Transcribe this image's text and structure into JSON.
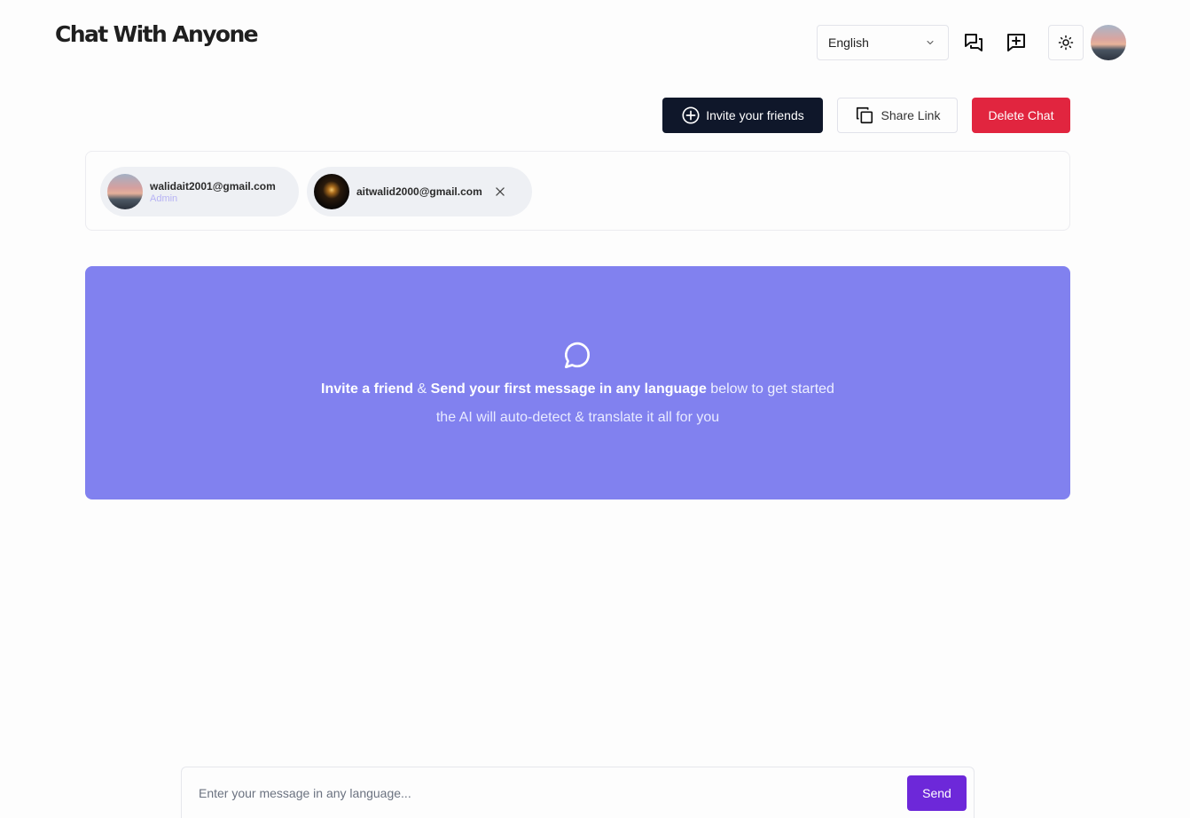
{
  "header": {
    "logo": "Chat With Anyone",
    "language": {
      "selected": "English",
      "icon": "chevron-down-icon"
    },
    "icons": [
      "chat-list-icon",
      "new-chat-icon",
      "sun-icon"
    ],
    "avatar": "user-avatar"
  },
  "actions": {
    "invite_label": "Invite your friends",
    "share_label": "Share Link",
    "delete_label": "Delete Chat",
    "colors": {
      "invite": "#0f172a",
      "delete": "#e1253f"
    }
  },
  "members": [
    {
      "email": "walidait2001@gmail.com",
      "role": "Admin"
    },
    {
      "email": "aitwalid2000@gmail.com",
      "remove_icon": "close-icon"
    }
  ],
  "empty_state": {
    "icon": "message-circle-icon",
    "line1": {
      "part1": "Invite a friend",
      "sep": " & ",
      "part2": "Send your first message in any language",
      "part3": " below to get started"
    },
    "line2": "the AI will auto-detect & translate it all for you",
    "color": "#8181ef"
  },
  "composer": {
    "placeholder": "Enter your message in any language...",
    "send_label": "Send",
    "send_color": "#6d28d9"
  }
}
